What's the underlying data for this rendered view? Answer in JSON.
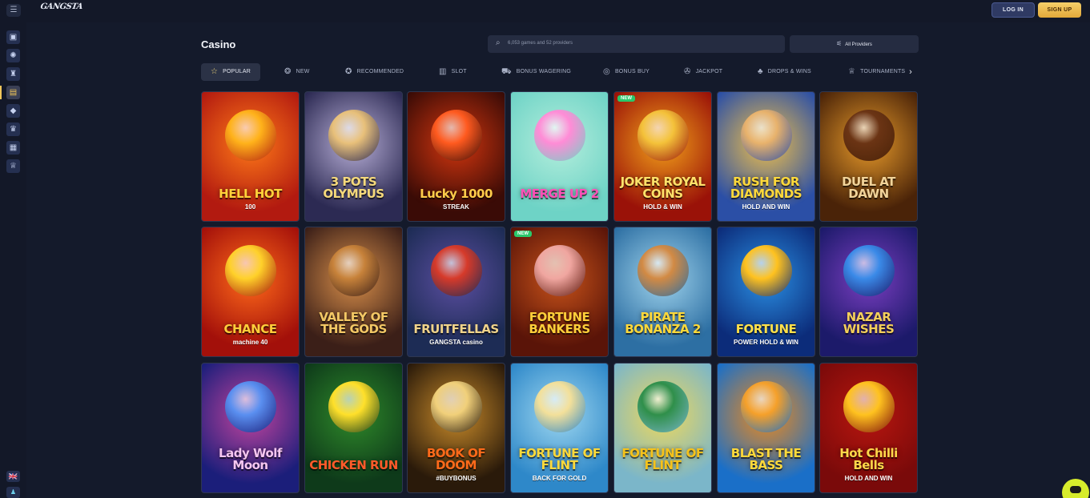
{
  "header": {
    "menu_icon": "menu-icon",
    "logo_text": "GANGSTA",
    "login_label": "LOG IN",
    "signup_label": "SIGN UP"
  },
  "sidebar": {
    "items": [
      {
        "icon": "gift-icon",
        "glyph": "▣"
      },
      {
        "icon": "wheel-icon",
        "glyph": "✺"
      },
      {
        "icon": "rocket-icon",
        "glyph": "♜"
      },
      {
        "icon": "slot-machine-icon",
        "glyph": "▤"
      },
      {
        "icon": "diamond-icon",
        "glyph": "◆"
      },
      {
        "icon": "trophy-icon",
        "glyph": "♛"
      },
      {
        "icon": "shop-icon",
        "glyph": "▦"
      },
      {
        "icon": "crown-icon",
        "glyph": "♕"
      }
    ],
    "active_index": 3,
    "language_flag": "🇬🇧",
    "bottom_icon": "♟"
  },
  "main": {
    "title": "Casino",
    "search_placeholder": "6,053 games and 52 providers",
    "providers_label": "All Providers"
  },
  "tabs": [
    {
      "label": "POPULAR",
      "icon": "star-icon",
      "glyph": "☆",
      "active": true
    },
    {
      "label": "NEW",
      "icon": "fire-icon",
      "glyph": "❂",
      "active": false
    },
    {
      "label": "RECOMMENDED",
      "icon": "badge-icon",
      "glyph": "✪",
      "active": false
    },
    {
      "label": "SLOT",
      "icon": "slot-icon",
      "glyph": "▥",
      "active": false
    },
    {
      "label": "BONUS WAGERING",
      "icon": "bonus-icon",
      "glyph": "⛟",
      "active": false
    },
    {
      "label": "BONUS BUY",
      "icon": "coins-icon",
      "glyph": "◎",
      "active": false
    },
    {
      "label": "JACKPOT",
      "icon": "jackpot-icon",
      "glyph": "✇",
      "active": false
    },
    {
      "label": "DROPS & WINS",
      "icon": "drops-icon",
      "glyph": "♣",
      "active": false
    },
    {
      "label": "TOURNAMENTS",
      "icon": "trophy-icon",
      "glyph": "♕",
      "active": false
    }
  ],
  "tab_next_icon": "chevron-right-icon",
  "games": [
    {
      "title": "HELL HOT",
      "sub": "100",
      "bg": "#b21a10",
      "bg2": "#ff7a18",
      "fg": "#ffd23a",
      "art": "#ffb21a",
      "badge": ""
    },
    {
      "title": "3 POTS OLYMPUS",
      "sub": "",
      "bg": "#2c2a53",
      "bg2": "#b9b0d8",
      "fg": "#f5d97b",
      "art": "#e8c07a",
      "badge": ""
    },
    {
      "title": "Lucky 1000",
      "sub": "STREAK",
      "bg": "#3a0b06",
      "bg2": "#d3360f",
      "fg": "#ffcc4a",
      "art": "#ff5a1f",
      "badge": ""
    },
    {
      "title": "MERGE UP 2",
      "sub": "",
      "bg": "#6ed3c6",
      "bg2": "#b4eedc",
      "fg": "#ff4fb7",
      "art": "#ff8cd6",
      "badge": ""
    },
    {
      "title": "JOKER ROYAL COINS",
      "sub": "HOLD & WIN",
      "bg": "#9a1208",
      "bg2": "#f3a21a",
      "fg": "#ffe26a",
      "art": "#f4c23a",
      "badge": "NEW"
    },
    {
      "title": "RUSH FOR DIAMONDS",
      "sub": "HOLD AND WIN",
      "bg": "#2b4fa6",
      "bg2": "#f1c14a",
      "fg": "#ffd93a",
      "art": "#e8b26c",
      "badge": ""
    },
    {
      "title": "DUEL AT DAWN",
      "sub": "",
      "bg": "#4a2308",
      "bg2": "#e79a2a",
      "fg": "#f2d49a",
      "art": "#6b3414",
      "badge": ""
    },
    {
      "title": "CHANCE",
      "sub": "machine 40",
      "bg": "#a3100a",
      "bg2": "#ff6a1a",
      "fg": "#ffce3a",
      "art": "#ffd12a",
      "badge": ""
    },
    {
      "title": "VALLEY OF THE GODS",
      "sub": "",
      "bg": "#3b1f18",
      "bg2": "#d98f4a",
      "fg": "#f3c865",
      "art": "#c7823a",
      "badge": ""
    },
    {
      "title": "FRUITFELLAS",
      "sub": "GANGSTA casino",
      "bg": "#1d2c55",
      "bg2": "#5b4ea1",
      "fg": "#f0d38a",
      "art": "#d63a2a",
      "badge": ""
    },
    {
      "title": "FORTUNE BANKERS",
      "sub": "",
      "bg": "#5a1408",
      "bg2": "#c8531a",
      "fg": "#ffcf3a",
      "art": "#f0a6a0",
      "badge": "NEW"
    },
    {
      "title": "PIRATE BONANZA 2",
      "sub": "",
      "bg": "#2d6fa3",
      "bg2": "#9fd3ec",
      "fg": "#ffd93a",
      "art": "#d28a44",
      "badge": ""
    },
    {
      "title": "FORTUNE",
      "sub": "POWER HOLD & WIN",
      "bg": "#0c2c7a",
      "bg2": "#2a8fe3",
      "fg": "#ffe14a",
      "art": "#ffc21f",
      "badge": ""
    },
    {
      "title": "NAZAR WISHES",
      "sub": "",
      "bg": "#1c1a6a",
      "bg2": "#7a3ec1",
      "fg": "#f4cf5a",
      "art": "#3a8ae8",
      "badge": ""
    },
    {
      "title": "Lady Wolf Moon",
      "sub": "",
      "bg": "#1b1e7a",
      "bg2": "#c2449e",
      "fg": "#f5c6f0",
      "art": "#5a8ff0",
      "badge": ""
    },
    {
      "title": "CHICKEN RUN",
      "sub": "",
      "bg": "#0e3a1a",
      "bg2": "#2f8a2a",
      "fg": "#ff5a2a",
      "art": "#ffe02a",
      "badge": ""
    },
    {
      "title": "BOOK OF DOOM",
      "sub": "#BUYBONUS",
      "bg": "#2a1a0a",
      "bg2": "#c98b2a",
      "fg": "#ff6a1a",
      "art": "#f1d07a",
      "badge": ""
    },
    {
      "title": "FORTUNE OF FLINT",
      "sub": "BACK FOR GOLD",
      "bg": "#2e88c9",
      "bg2": "#9ed7f0",
      "fg": "#ffd93a",
      "art": "#f3e09a",
      "badge": ""
    },
    {
      "title": "FORTUNE OF FLINT",
      "sub": "",
      "bg": "#7bb6c9",
      "bg2": "#f0d95a",
      "fg": "#f6c21a",
      "art": "#2f8f4a",
      "badge": ""
    },
    {
      "title": "BLAST THE BASS",
      "sub": "",
      "bg": "#1a6fc8",
      "bg2": "#f08a1a",
      "fg": "#ffd93a",
      "art": "#f5a02a",
      "badge": ""
    },
    {
      "title": "Hot Chilli Bells",
      "sub": "HOLD AND WIN",
      "bg": "#7a0a0a",
      "bg2": "#b8160f",
      "fg": "#ffd84a",
      "art": "#ffc21f",
      "badge": ""
    }
  ],
  "chat_icon": "chat-icon"
}
